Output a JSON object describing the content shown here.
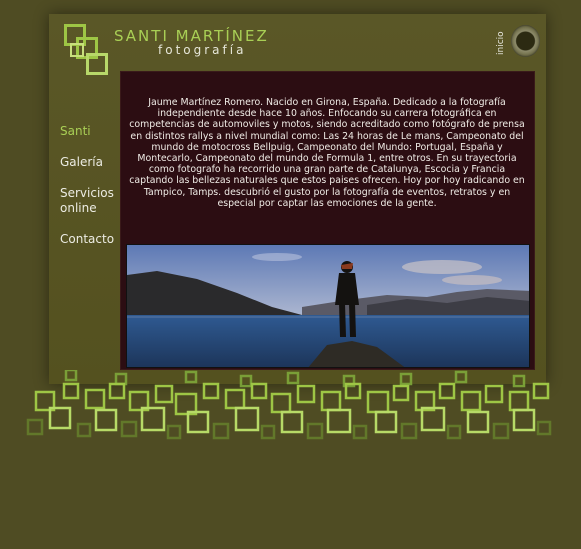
{
  "brand": {
    "name": "SANTI MARTÍNEZ",
    "subtitle": "fotografía"
  },
  "header": {
    "inicio_label": "inicio"
  },
  "nav": {
    "items": [
      {
        "label": "Santi",
        "active": true
      },
      {
        "label": "Galería",
        "active": false
      },
      {
        "label": "Servicios online",
        "active": false
      },
      {
        "label": "Contacto",
        "active": false
      }
    ]
  },
  "main": {
    "bio": "Jaume Martínez Romero. Nacido en Girona, España. Dedicado a la fotografía independiente desde hace 10 años. Enfocando su carrera fotográfica en competencias de automoviles y motos, siendo acreditado como fotógrafo de prensa en distintos rallys a nivel mundial como: Las 24 horas de Le mans, Campeonato del mundo de motocross Bellpuig, Campeonato del Mundo: Portugal, España y Montecarlo, Campeonato del mundo de Formula 1, entre otros. En su trayectoria como fotografo ha recorrido una gran parte de Catalunya, Escocia y Francia captando las bellezas naturales que estos paises ofrecen. Hoy por hoy radicando en Tampico, Tamps. descubrió el gusto por la fotografía de eventos, retratos y en especial por captar las emociones de la gente."
  },
  "colors": {
    "background": "#4f4c23",
    "accent_green": "#a9cf55",
    "content_bg": "#2c0d12",
    "text_light": "#f0ece6"
  },
  "icons": {
    "logo": "squares-logo-icon",
    "inicio": "ring-home-icon"
  }
}
